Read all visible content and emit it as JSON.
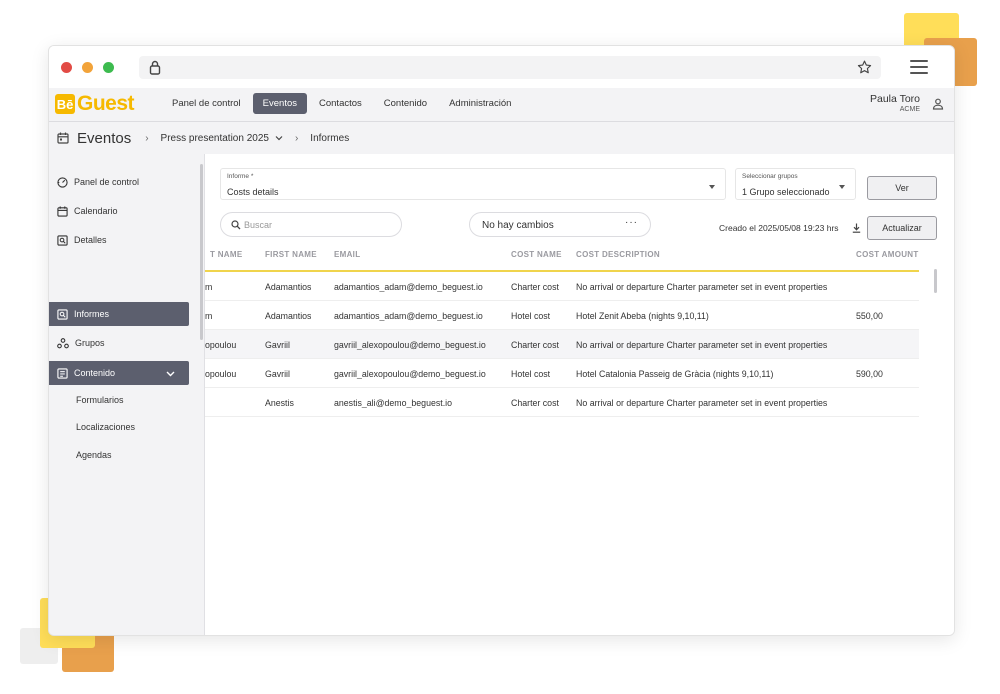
{
  "colors": {
    "accent": "#f6b900",
    "nav_active": "#5c5f6e",
    "header_line": "#f0d44c",
    "traffic_red": "#e24b45",
    "traffic_yellow": "#f2a33a",
    "traffic_green": "#3dbb4f"
  },
  "browser": {
    "lock_icon": "lock-icon",
    "bookmark_icon": "star-icon",
    "menu_icon": "hamburger-icon"
  },
  "logo": {
    "be": "Bē",
    "guest": "Guest"
  },
  "topnav": {
    "items": [
      {
        "label": "Panel de control",
        "active": false
      },
      {
        "label": "Eventos",
        "active": true
      },
      {
        "label": "Contactos",
        "active": false
      },
      {
        "label": "Contenido",
        "active": false
      },
      {
        "label": "Administración",
        "active": false
      }
    ],
    "user": {
      "name": "Paula Toro",
      "org": "ACME"
    }
  },
  "breadcrumb": {
    "title": "Eventos",
    "event": "Press presentation 2025",
    "page": "Informes"
  },
  "sidebar": {
    "items": [
      {
        "label": "Panel de control",
        "icon": "dashboard-icon"
      },
      {
        "label": "Calendario",
        "icon": "calendar-icon"
      },
      {
        "label": "Detalles",
        "icon": "details-icon"
      },
      {
        "label": "Informes",
        "icon": "reports-icon",
        "active": true
      },
      {
        "label": "Grupos",
        "icon": "groups-icon"
      },
      {
        "label": "Contenido",
        "icon": "content-icon",
        "active": true,
        "expanded": true
      }
    ],
    "subitems": [
      "Formularios",
      "Localizaciones",
      "Agendas"
    ]
  },
  "filters": {
    "report": {
      "label": "Informe *",
      "value": "Costs details"
    },
    "groups": {
      "label": "Seleccionar grupos",
      "value": "1 Grupo seleccionado"
    },
    "view_button": "Ver"
  },
  "toolbar": {
    "search_placeholder": "Buscar",
    "changes": "No hay cambios",
    "changes_menu": "···",
    "created": "Creado el 2025/05/08 19:23 hrs",
    "update_button": "Actualizar"
  },
  "table": {
    "headers": [
      "T NAME",
      "FIRST NAME",
      "EMAIL",
      "COST NAME",
      "COST DESCRIPTION",
      "COST AMOUNT"
    ],
    "rows": [
      [
        "m",
        "Adamantios",
        "adamantios_adam@demo_beguest.io",
        "Charter cost",
        "No arrival or departure Charter parameter set in event properties",
        ""
      ],
      [
        "m",
        "Adamantios",
        "adamantios_adam@demo_beguest.io",
        "Hotel cost",
        "Hotel Zenit Abeba (nights 9,10,11)",
        "550,00"
      ],
      [
        "opoulou",
        "Gavriil",
        "gavriil_alexopoulou@demo_beguest.io",
        "Charter cost",
        "No arrival or departure Charter parameter set in event properties",
        ""
      ],
      [
        "opoulou",
        "Gavriil",
        "gavriil_alexopoulou@demo_beguest.io",
        "Hotel cost",
        "Hotel Catalonia Passeig de Gràcia (nights 9,10,11)",
        "590,00"
      ],
      [
        "",
        "Anestis",
        "anestis_ali@demo_beguest.io",
        "Charter cost",
        "No arrival or departure Charter parameter set in event properties",
        ""
      ]
    ]
  }
}
